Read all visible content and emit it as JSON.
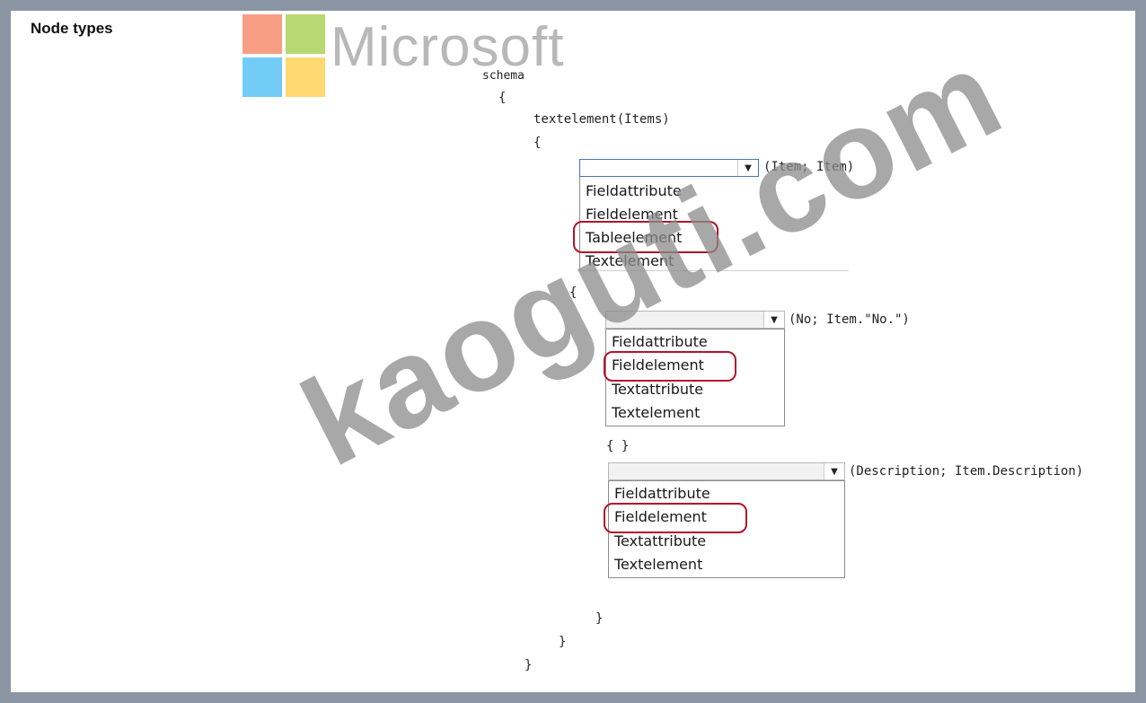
{
  "title": "Node types",
  "logo": {
    "text": "Microsoft",
    "colors": [
      "#f25022",
      "#7fba00",
      "#00a4ef",
      "#ffb900"
    ]
  },
  "code": {
    "schema": "schema",
    "brace_open_1": "{",
    "textelement": "textelement(Items)",
    "brace_open_2": "{",
    "brace_open_3": "{",
    "empty_braces": "{ }",
    "brace_close_1": "}",
    "brace_close_2": "}",
    "brace_close_3": "}"
  },
  "dropdowns": [
    {
      "selected": "",
      "suffix": "(Item; Item)",
      "options": [
        "Fieldattribute",
        "Fieldelement",
        "Tableelement",
        "Textelement"
      ],
      "highlighted": "Tableelement"
    },
    {
      "selected": "",
      "suffix": "(No; Item.\"No.\")",
      "options": [
        "Fieldattribute",
        "Fieldelement",
        "Textattribute",
        "Textelement"
      ],
      "highlighted": "Fieldelement"
    },
    {
      "selected": "",
      "suffix": "(Description; Item.Description)",
      "options": [
        "Fieldattribute",
        "Fieldelement",
        "Textattribute",
        "Textelement"
      ],
      "highlighted": "Fieldelement"
    }
  ],
  "watermark": "kaoguti.com",
  "highlight_color": "#b0152a"
}
